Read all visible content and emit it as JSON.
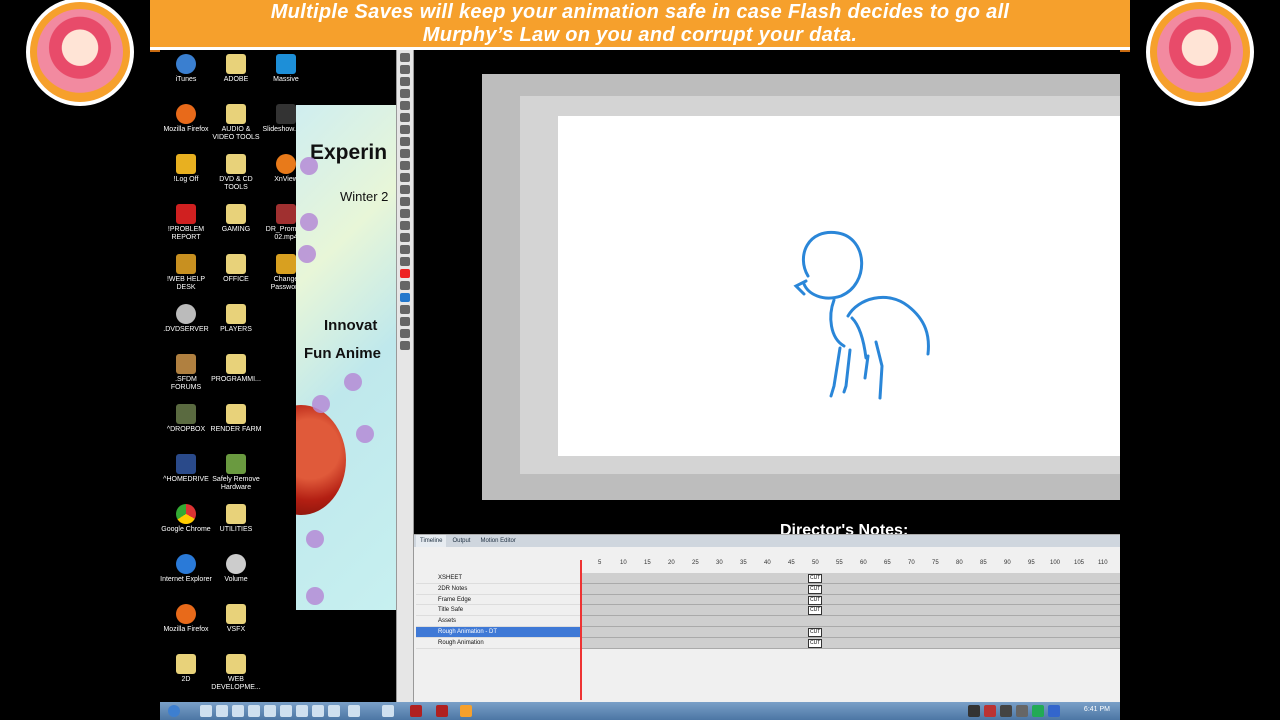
{
  "banner": {
    "line1_em": "Multiple Saves",
    "line1_rest": " will keep your animation safe in case Flash decides to go all",
    "line2_em": "Murphy’s Law",
    "line2_rest": " on you and corrupt your data."
  },
  "desktop": {
    "icons": [
      {
        "label": "iTunes"
      },
      {
        "label": "ADOBE"
      },
      {
        "label": "Massive"
      },
      {
        "label": "Mozilla Firefox"
      },
      {
        "label": "AUDIO & VIDEO TOOLS"
      },
      {
        "label": "Slideshow.mp4"
      },
      {
        "label": "!Log Off"
      },
      {
        "label": "DVD & CD TOOLS"
      },
      {
        "label": "XnView"
      },
      {
        "label": "!PROBLEM REPORT"
      },
      {
        "label": "GAMING"
      },
      {
        "label": "DR_Promo... 02.mp4"
      },
      {
        "label": "!WEB HELP DESK"
      },
      {
        "label": "OFFICE"
      },
      {
        "label": "Change Password"
      },
      {
        "label": ".DVDSERVER"
      },
      {
        "label": "PLAYERS"
      },
      {
        "label": ".SFDM FORUMS"
      },
      {
        "label": "PROGRAMMI..."
      },
      {
        "label": "^DROPBOX"
      },
      {
        "label": "RENDER FARM"
      },
      {
        "label": "^HOMEDRIVE"
      },
      {
        "label": "Safely Remove Hardware"
      },
      {
        "label": "Google Chrome"
      },
      {
        "label": "UTILITIES"
      },
      {
        "label": "Internet Explorer"
      },
      {
        "label": "Volume"
      },
      {
        "label": "Mozilla Firefox"
      },
      {
        "label": "VSFX"
      },
      {
        "label": "2D"
      },
      {
        "label": "WEB DEVELOPME..."
      }
    ]
  },
  "preview": {
    "title": "Experin",
    "subtitle": "Winter 2",
    "line3": "Innovat",
    "line4": "Fun Anime"
  },
  "stage": {
    "notes_heading": "Director's Notes:"
  },
  "timeline": {
    "tabs": [
      "Timeline",
      "Output",
      "Motion Editor"
    ],
    "ruler": [
      "5",
      "10",
      "15",
      "20",
      "25",
      "30",
      "35",
      "40",
      "45",
      "50",
      "55",
      "60",
      "65",
      "70",
      "75",
      "80",
      "85",
      "90",
      "95",
      "100",
      "105",
      "110"
    ],
    "layers": [
      {
        "name": "XSHEET"
      },
      {
        "name": "2DR Notes"
      },
      {
        "name": "Frame Edge"
      },
      {
        "name": "Title Safe"
      },
      {
        "name": "Assets"
      },
      {
        "name": "Rough Animation - DT"
      },
      {
        "name": "Rough Animation"
      }
    ],
    "cut_label": "CUT"
  },
  "taskbar": {
    "clock": "6:41 PM"
  },
  "colors": {
    "banner": "#f6a02c",
    "stroke": "#2a86d8",
    "selected_layer": "#3f79d6"
  }
}
